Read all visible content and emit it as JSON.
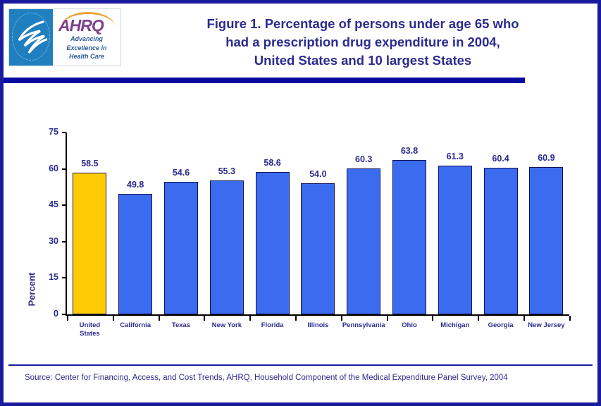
{
  "figure": {
    "border_color": "#1a1a9e",
    "title_lines": [
      "Figure 1. Percentage of persons under age 65 who",
      "had a prescription drug expenditure in 2004,",
      "United States and 10 largest States"
    ],
    "title_full": "Figure 1. Percentage of persons under age 65 who had a prescription drug expenditure in 2004, United States and 10 largest States",
    "source": "Source: Center for Financing, Access, and Cost Trends, AHRQ, Household Component of the Medical Expenditure Panel Survey, 2004"
  },
  "logo": {
    "agency_acronym": "AHRQ",
    "tagline_lines": [
      "Advancing",
      "Excellence in",
      "Health Care"
    ],
    "seal_name": "hhs-eagle-seal-icon",
    "seal_color": "#1f7fbf",
    "acronym_color": "#7b3f8c",
    "tagline_color": "#2a5c9b"
  },
  "chart_data": {
    "type": "bar",
    "title": "Figure 1. Percentage of persons under age 65 who had a prescription drug expenditure in 2004, United States and 10 largest States",
    "xlabel": "",
    "ylabel": "Percent",
    "ylim": [
      0,
      75
    ],
    "yticks": [
      0,
      15,
      30,
      45,
      60,
      75
    ],
    "ytick_labels": [
      "0",
      "15",
      "30",
      "45",
      "60",
      "75"
    ],
    "grid": false,
    "legend": null,
    "categories": [
      "United States",
      "California",
      "Texas",
      "New York",
      "Florida",
      "Illinois",
      "Pennsylvania",
      "Ohio",
      "Michigan",
      "Georgia",
      "New Jersey"
    ],
    "category_label_lines": [
      [
        "United",
        "States"
      ],
      [
        "California"
      ],
      [
        "Texas"
      ],
      [
        "New York"
      ],
      [
        "Florida"
      ],
      [
        "Illinois"
      ],
      [
        "Pennsylvania"
      ],
      [
        "Ohio"
      ],
      [
        "Michigan"
      ],
      [
        "Georgia"
      ],
      [
        "New Jersey"
      ]
    ],
    "values": [
      58.5,
      49.8,
      54.6,
      55.3,
      58.6,
      54.0,
      60.3,
      63.8,
      61.3,
      60.4,
      60.9
    ],
    "value_labels": [
      "58.5",
      "49.8",
      "54.6",
      "55.3",
      "58.6",
      "54.0",
      "60.3",
      "63.8",
      "61.3",
      "60.4",
      "60.9"
    ],
    "bar_colors": [
      "#ffcb05",
      "#3b6cf0",
      "#3b6cf0",
      "#3b6cf0",
      "#3b6cf0",
      "#3b6cf0",
      "#3b6cf0",
      "#3b6cf0",
      "#3b6cf0",
      "#3b6cf0",
      "#3b6cf0"
    ],
    "bar_edge_color": "#121255",
    "highlight_index": 0,
    "text_color": "#2b2b8f"
  }
}
